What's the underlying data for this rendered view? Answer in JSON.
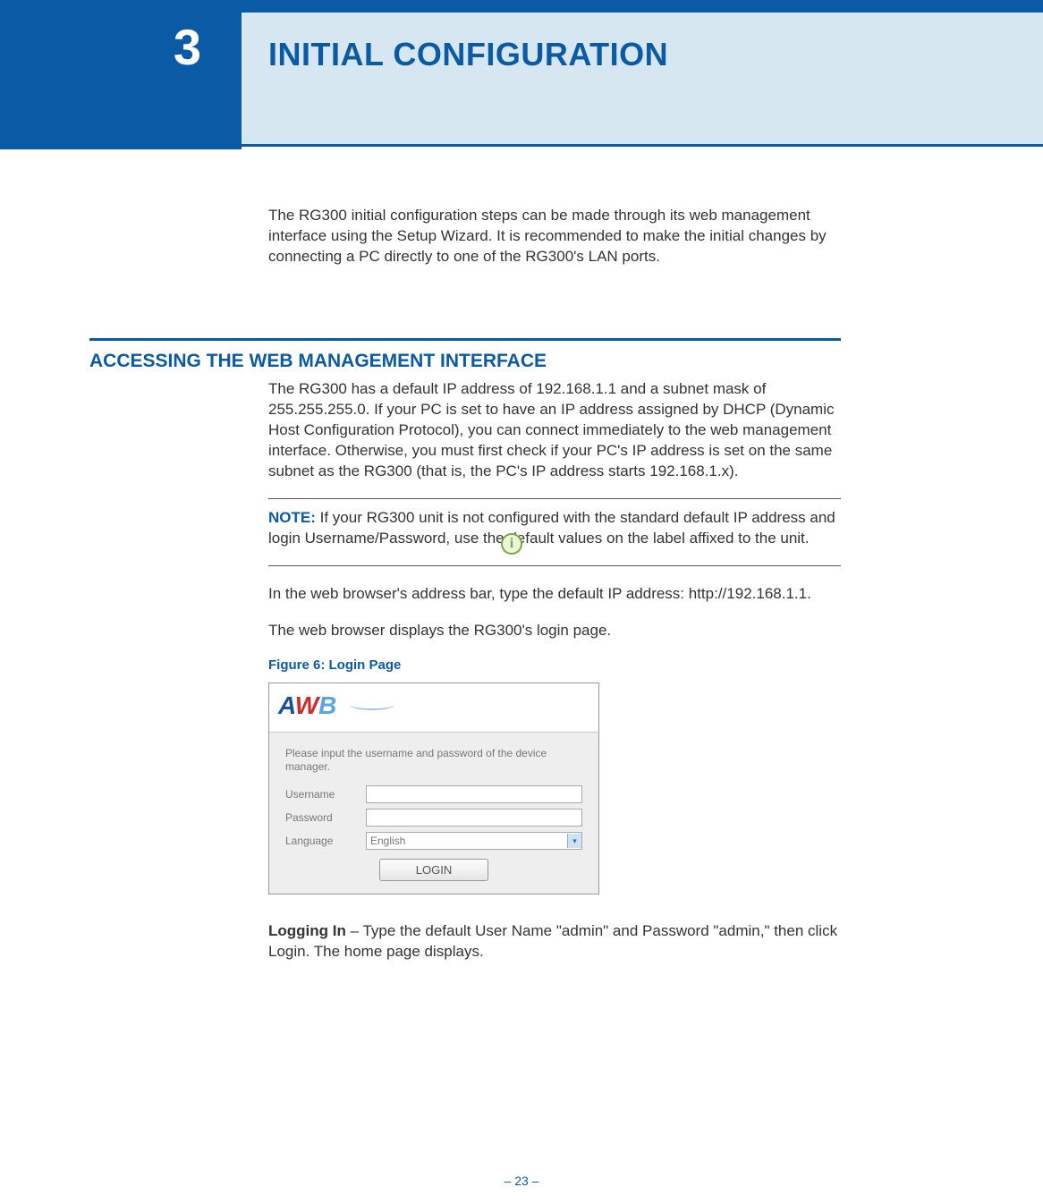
{
  "chapter": {
    "number": "3",
    "title": "INITIAL CONFIGURATION"
  },
  "intro": "The RG300 initial configuration steps can be made through its web management interface using the Setup Wizard. It is recommended to make the initial changes by connecting a PC directly to one of the RG300's LAN ports.",
  "section1": {
    "heading": "ACCESSING THE WEB MANAGEMENT INTERFACE",
    "p1": "The RG300 has a default IP address of 192.168.1.1 and a subnet mask of 255.255.255.0. If your PC is set to have an IP address assigned by DHCP (Dynamic Host Configuration Protocol), you can connect immediately to the web management interface. Otherwise, you must first check if your PC's IP address is set on the same subnet as the RG300 (that is, the PC's IP address starts 192.168.1.x)."
  },
  "note": {
    "label": "NOTE:",
    "text": " If your RG300 unit is not configured with the standard default IP address and login Username/Password, use the default values on the label affixed to the unit."
  },
  "p_after_note1": "In the web browser's address bar, type the default IP address: http://192.168.1.1.",
  "p_after_note2": "The web browser displays the RG300's login page.",
  "figure": {
    "caption": "Figure 6:  Login Page",
    "instruction": "Please input the username and password of the device manager.",
    "username_label": "Username",
    "password_label": "Password",
    "language_label": "Language",
    "language_value": "English",
    "login_button": "LOGIN",
    "logo_a": "A",
    "logo_w": "W",
    "logo_b": "B"
  },
  "logging_in": {
    "label": "Logging In",
    "text": " – Type the default User Name \"admin\" and Password \"admin,\" then click Login. The home page displays."
  },
  "page_number": "–  23  –"
}
